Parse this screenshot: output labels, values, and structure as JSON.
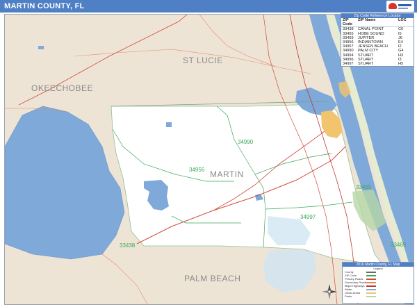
{
  "title": "MARTIN COUNTY, FL",
  "brand_icon": "map-publisher-logo",
  "county_labels": {
    "st_lucie": "ST LUCIE",
    "okeechobee": "OKEECHOBEE",
    "martin": "MARTIN",
    "palm_beach": "PALM BEACH"
  },
  "zip_labels": {
    "z34990": "34990",
    "z34956": "34956",
    "z33455": "33455",
    "z34997": "34997",
    "z33438": "33438",
    "z33469": "33469"
  },
  "zip_table": {
    "header": "Zip Code Reference Locator",
    "columns": [
      "ZIP Code",
      "ZIP Name",
      "LOC"
    ],
    "rows": [
      [
        "33438",
        "CANAL POINT",
        "C6"
      ],
      [
        "33455",
        "HOBE SOUND",
        "I5"
      ],
      [
        "33469",
        "JUPITER",
        "J6"
      ],
      [
        "34956",
        "INDIANTOWN",
        "E4"
      ],
      [
        "34957",
        "JENSEN BEACH",
        "I2"
      ],
      [
        "34990",
        "PALM CITY",
        "G4"
      ],
      [
        "34994",
        "STUART",
        "H3"
      ],
      [
        "34996",
        "STUART",
        "I3"
      ],
      [
        "34997",
        "STUART",
        "H5"
      ]
    ]
  },
  "legend": {
    "header": "2016 Martin County, FL Map",
    "subheader": "Legend",
    "items": [
      {
        "label": "County",
        "color": "#6a6a6a"
      },
      {
        "label": "ZIP Code",
        "color": "#3aa85a"
      },
      {
        "label": "Primary Roads",
        "color": "#d24b3a"
      },
      {
        "label": "Secondary Roads",
        "color": "#e08a6a"
      },
      {
        "label": "Major Highways",
        "color": "#c0392b"
      },
      {
        "label": "Water",
        "color": "#7ea9d8"
      },
      {
        "label": "Urban Areas",
        "color": "#f2c46d"
      },
      {
        "label": "Parks",
        "color": "#b7d7a8"
      }
    ]
  },
  "colors": {
    "title_bar": "#4f7fc4",
    "water": "#7ea9d8",
    "land_outside": "#eee4d6",
    "county": "#ffffff",
    "zip_line": "#3aa85a",
    "road": "#d24b3a",
    "urban": "#f2c46d"
  },
  "compass_icon": "compass-rose-icon"
}
